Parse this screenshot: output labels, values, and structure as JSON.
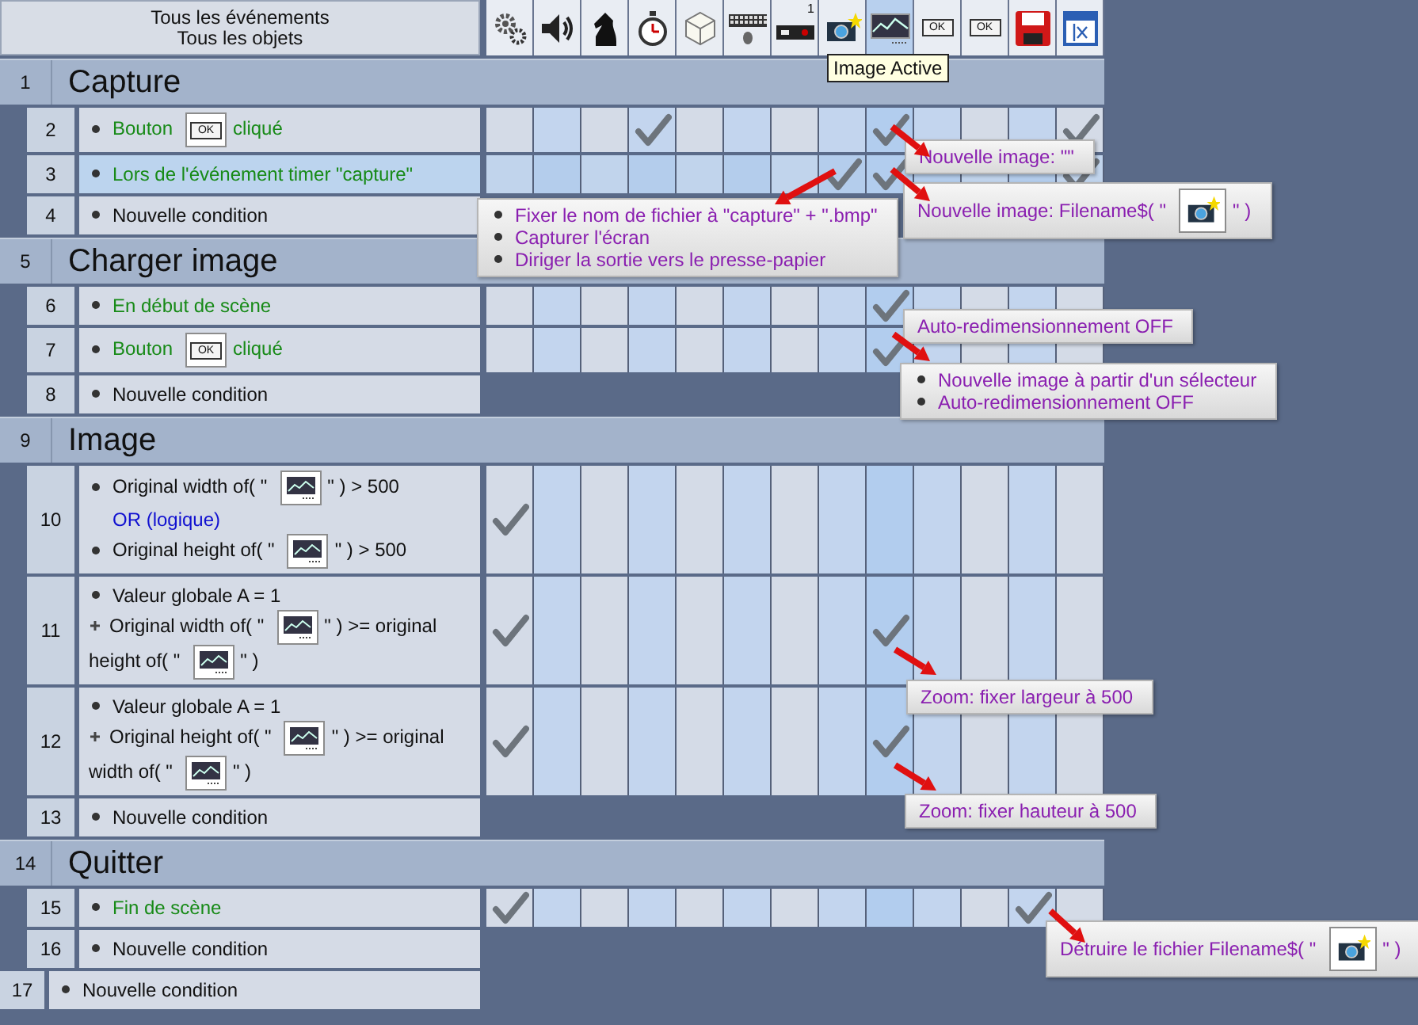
{
  "header": {
    "lines": [
      "Tous les événements",
      "Tous les objets"
    ]
  },
  "columns": [
    {
      "kind": "gear",
      "selected": false
    },
    {
      "kind": "speaker",
      "selected": false
    },
    {
      "kind": "knight",
      "selected": false
    },
    {
      "kind": "stopwatch",
      "selected": false
    },
    {
      "kind": "cube",
      "selected": false
    },
    {
      "kind": "keyboard",
      "selected": false
    },
    {
      "kind": "device",
      "label": "1",
      "selected": false
    },
    {
      "kind": "camera",
      "selected": false
    },
    {
      "kind": "image",
      "selected": true
    },
    {
      "kind": "button",
      "label": "OK",
      "selected": false
    },
    {
      "kind": "button",
      "label": "OK",
      "selected": false
    },
    {
      "kind": "floppy",
      "selected": false
    },
    {
      "kind": "table",
      "selected": false
    }
  ],
  "tooltip": {
    "text": "Image Active"
  },
  "rows": [
    {
      "kind": "group",
      "number": "1",
      "title": "Capture",
      "children": [
        {
          "kind": "event",
          "number": "2",
          "selected": false,
          "conditions": [
            {
              "kind": "trigger",
              "parts": [
                {
                  "kind": "text",
                  "text": "Bouton"
                },
                {
                  "kind": "button",
                  "label": "OK"
                },
                {
                  "kind": "text",
                  "text": "cliqué"
                }
              ]
            }
          ],
          "cells": [
            false,
            false,
            false,
            true,
            false,
            false,
            false,
            false,
            true,
            false,
            false,
            false,
            true
          ]
        },
        {
          "kind": "event",
          "number": "3",
          "selected": true,
          "conditions": [
            {
              "kind": "trigger",
              "parts": [
                {
                  "kind": "text",
                  "text": "Lors de l'événement timer \"capture\""
                }
              ]
            }
          ],
          "cells": [
            false,
            false,
            false,
            false,
            false,
            false,
            false,
            true,
            true,
            false,
            false,
            false,
            true
          ]
        },
        {
          "kind": "new",
          "number": "4",
          "text": "Nouvelle condition"
        }
      ]
    },
    {
      "kind": "group",
      "number": "5",
      "title": "Charger image",
      "children": [
        {
          "kind": "event",
          "number": "6",
          "selected": false,
          "conditions": [
            {
              "kind": "trigger",
              "parts": [
                {
                  "kind": "text",
                  "text": "En début de scène"
                }
              ]
            }
          ],
          "cells": [
            false,
            false,
            false,
            false,
            false,
            false,
            false,
            false,
            true,
            false,
            false,
            false,
            false
          ]
        },
        {
          "kind": "event",
          "number": "7",
          "selected": false,
          "conditions": [
            {
              "kind": "trigger",
              "parts": [
                {
                  "kind": "text",
                  "text": "Bouton"
                },
                {
                  "kind": "button",
                  "label": "OK"
                },
                {
                  "kind": "text",
                  "text": "cliqué"
                }
              ]
            }
          ],
          "cells": [
            false,
            false,
            false,
            false,
            false,
            false,
            false,
            false,
            true,
            false,
            false,
            false,
            false
          ]
        },
        {
          "kind": "new",
          "number": "8",
          "text": "Nouvelle condition"
        }
      ]
    },
    {
      "kind": "group",
      "number": "9",
      "title": "Image",
      "children": [
        {
          "kind": "event",
          "number": "10",
          "selected": false,
          "conditions": [
            {
              "kind": "condition",
              "parts": [
                {
                  "kind": "text",
                  "text": "Original width of( \""
                },
                {
                  "kind": "image"
                },
                {
                  "kind": "text",
                  "text": "\" ) > 500"
                }
              ]
            },
            {
              "kind": "or",
              "parts": [
                {
                  "kind": "text",
                  "text": "OR (logique)"
                }
              ]
            },
            {
              "kind": "condition",
              "parts": [
                {
                  "kind": "text",
                  "text": "Original height of( \""
                },
                {
                  "kind": "image"
                },
                {
                  "kind": "text",
                  "text": "\" ) > 500"
                }
              ]
            }
          ],
          "cells": [
            true,
            false,
            false,
            false,
            false,
            false,
            false,
            false,
            false,
            false,
            false,
            false,
            false
          ]
        },
        {
          "kind": "event",
          "number": "11",
          "selected": false,
          "conditions": [
            {
              "kind": "condition",
              "parts": [
                {
                  "kind": "text",
                  "text": "Valeur globale A = 1"
                }
              ]
            },
            {
              "kind": "and",
              "parts": [
                {
                  "kind": "text",
                  "text": "Original width of( \""
                },
                {
                  "kind": "image"
                },
                {
                  "kind": "text",
                  "text": "\" ) >= original"
                },
                {
                  "kind": "text",
                  "text": "height of( \""
                },
                {
                  "kind": "image"
                },
                {
                  "kind": "text",
                  "text": "\" )"
                }
              ]
            }
          ],
          "cells": [
            true,
            false,
            false,
            false,
            false,
            false,
            false,
            false,
            true,
            false,
            false,
            false,
            false
          ]
        },
        {
          "kind": "event",
          "number": "12",
          "selected": false,
          "conditions": [
            {
              "kind": "condition",
              "parts": [
                {
                  "kind": "text",
                  "text": "Valeur globale A = 1"
                }
              ]
            },
            {
              "kind": "and",
              "parts": [
                {
                  "kind": "text",
                  "text": "Original height of( \""
                },
                {
                  "kind": "image"
                },
                {
                  "kind": "text",
                  "text": "\" ) >= original"
                },
                {
                  "kind": "text",
                  "text": "width of( \""
                },
                {
                  "kind": "image"
                },
                {
                  "kind": "text",
                  "text": "\" )"
                }
              ]
            }
          ],
          "cells": [
            true,
            false,
            false,
            false,
            false,
            false,
            false,
            false,
            true,
            false,
            false,
            false,
            false
          ]
        },
        {
          "kind": "new",
          "number": "13",
          "text": "Nouvelle condition"
        }
      ]
    },
    {
      "kind": "group",
      "number": "14",
      "title": "Quitter",
      "children": [
        {
          "kind": "event",
          "number": "15",
          "selected": false,
          "conditions": [
            {
              "kind": "trigger",
              "parts": [
                {
                  "kind": "text",
                  "text": "Fin de scène"
                }
              ]
            }
          ],
          "cells": [
            true,
            false,
            false,
            false,
            false,
            false,
            false,
            false,
            false,
            false,
            false,
            true,
            false
          ]
        },
        {
          "kind": "new",
          "number": "16",
          "text": "Nouvelle condition"
        }
      ]
    },
    {
      "kind": "new",
      "number": "17",
      "text": "Nouvelle condition"
    }
  ],
  "actions": [
    {
      "bulleted": false,
      "arrow": true,
      "lines": [
        {
          "parts": [
            {
              "kind": "text",
              "text": "Nouvelle image: \"\""
            }
          ]
        }
      ]
    },
    {
      "bulleted": true,
      "arrow": true,
      "lines": [
        {
          "parts": [
            {
              "kind": "text",
              "text": "Fixer le nom de fichier à \"capture\" + \".bmp\""
            }
          ]
        },
        {
          "parts": [
            {
              "kind": "text",
              "text": "Capturer l'écran"
            }
          ]
        },
        {
          "parts": [
            {
              "kind": "text",
              "text": "Diriger la sortie vers le presse-papier"
            }
          ]
        }
      ]
    },
    {
      "bulleted": false,
      "arrow": true,
      "lines": [
        {
          "parts": [
            {
              "kind": "text",
              "text": "Nouvelle image: Filename$( \""
            },
            {
              "kind": "camera"
            },
            {
              "kind": "text",
              "text": "\" )"
            }
          ]
        }
      ]
    },
    {
      "bulleted": false,
      "arrow": false,
      "lines": [
        {
          "parts": [
            {
              "kind": "text",
              "text": "Auto-redimensionnement OFF"
            }
          ]
        }
      ]
    },
    {
      "bulleted": true,
      "arrow": true,
      "lines": [
        {
          "parts": [
            {
              "kind": "text",
              "text": "Nouvelle image à partir d'un sélecteur"
            }
          ]
        },
        {
          "parts": [
            {
              "kind": "text",
              "text": "Auto-redimensionnement OFF"
            }
          ]
        }
      ]
    },
    {
      "bulleted": false,
      "arrow": true,
      "lines": [
        {
          "parts": [
            {
              "kind": "text",
              "text": "Zoom: fixer largeur à 500"
            }
          ]
        }
      ]
    },
    {
      "bulleted": false,
      "arrow": true,
      "lines": [
        {
          "parts": [
            {
              "kind": "text",
              "text": "Zoom: fixer hauteur à 500"
            }
          ]
        }
      ]
    },
    {
      "bulleted": false,
      "arrow": true,
      "lines": [
        {
          "parts": [
            {
              "kind": "text",
              "text": "Détruire le fichier Filename$( \""
            },
            {
              "kind": "camera"
            },
            {
              "kind": "text",
              "text": "\" )"
            }
          ]
        }
      ]
    }
  ]
}
